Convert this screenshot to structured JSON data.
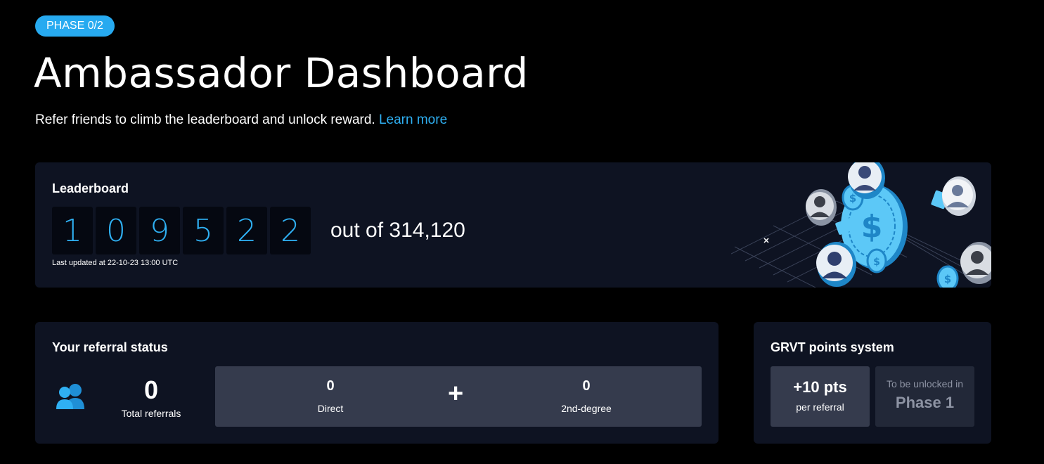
{
  "header": {
    "phase_badge": "PHASE 0/2",
    "title": "Ambassador Dashboard",
    "subtitle": "Refer friends to climb the leaderboard and unlock reward.",
    "learn_more": "Learn more"
  },
  "leaderboard": {
    "title": "Leaderboard",
    "rank_digits": [
      "1",
      "0",
      "9",
      "5",
      "2",
      "2"
    ],
    "out_of": "out of 314,120",
    "last_updated": "Last updated at 22-10-23 13:00 UTC",
    "illustration_icon": "coins-people-illustration"
  },
  "referral": {
    "title": "Your referral status",
    "icon": "users-icon",
    "total_value": "0",
    "total_label": "Total referrals",
    "direct_value": "0",
    "direct_label": "Direct",
    "plus": "+",
    "second_value": "0",
    "second_label": "2nd-degree"
  },
  "points": {
    "title": "GRVT points system",
    "per_referral_value": "+10 pts",
    "per_referral_label": "per referral",
    "locked_label": "To be unlocked in",
    "locked_phase": "Phase 1"
  },
  "colors": {
    "accent": "#27aaf0",
    "card_bg": "#0e1322",
    "box_bg": "#353b4d",
    "muted": "#8d93a3"
  }
}
